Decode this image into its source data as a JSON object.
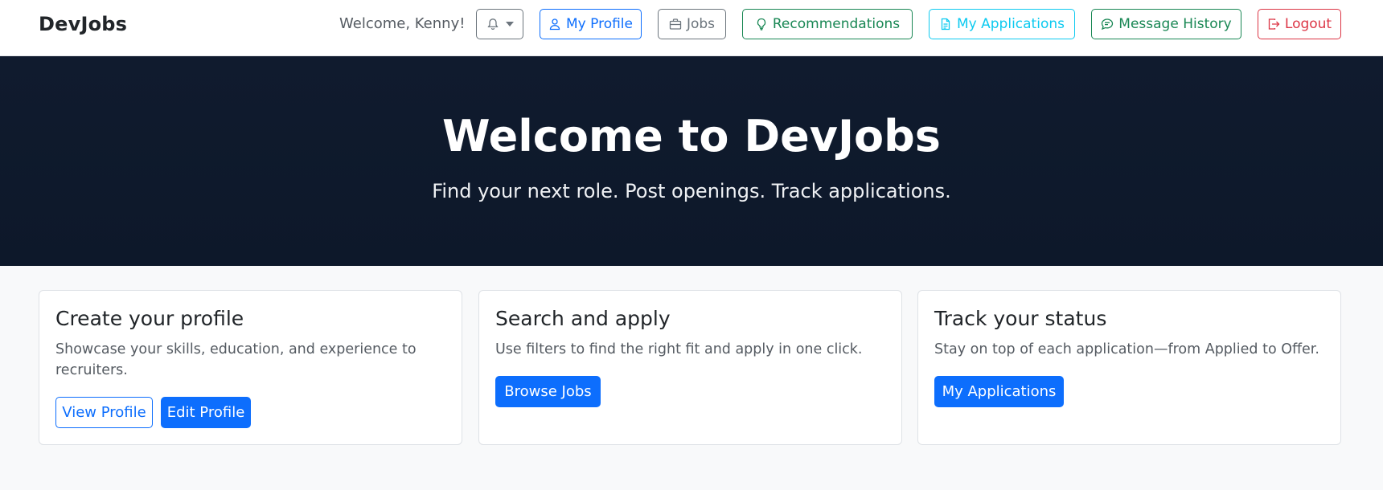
{
  "navbar": {
    "brand": "DevJobs",
    "welcome": "Welcome, Kenny!",
    "buttons": {
      "notifications_icon": "bell-icon",
      "my_profile": "My Profile",
      "jobs": "Jobs",
      "recommendations": "Recommendations",
      "my_applications": "My Applications",
      "message_history": "Message History",
      "logout": "Logout"
    }
  },
  "hero": {
    "title": "Welcome to DevJobs",
    "subtitle": "Find your next role. Post openings. Track applications."
  },
  "cards": [
    {
      "title": "Create your profile",
      "text": "Showcase your skills, education, and experience to recruiters.",
      "buttons": [
        "View Profile",
        "Edit Profile"
      ]
    },
    {
      "title": "Search and apply",
      "text": "Use filters to find the right fit and apply in one click.",
      "buttons": [
        "Browse Jobs"
      ]
    },
    {
      "title": "Track your status",
      "text": "Stay on top of each application—from Applied to Offer.",
      "buttons": [
        "My Applications"
      ]
    }
  ],
  "colors": {
    "primary": "#0d6efd",
    "secondary": "#6c757d",
    "success": "#198754",
    "info": "#0dcaf0",
    "danger": "#dc3545",
    "hero_bg": "#0f1a2c"
  }
}
